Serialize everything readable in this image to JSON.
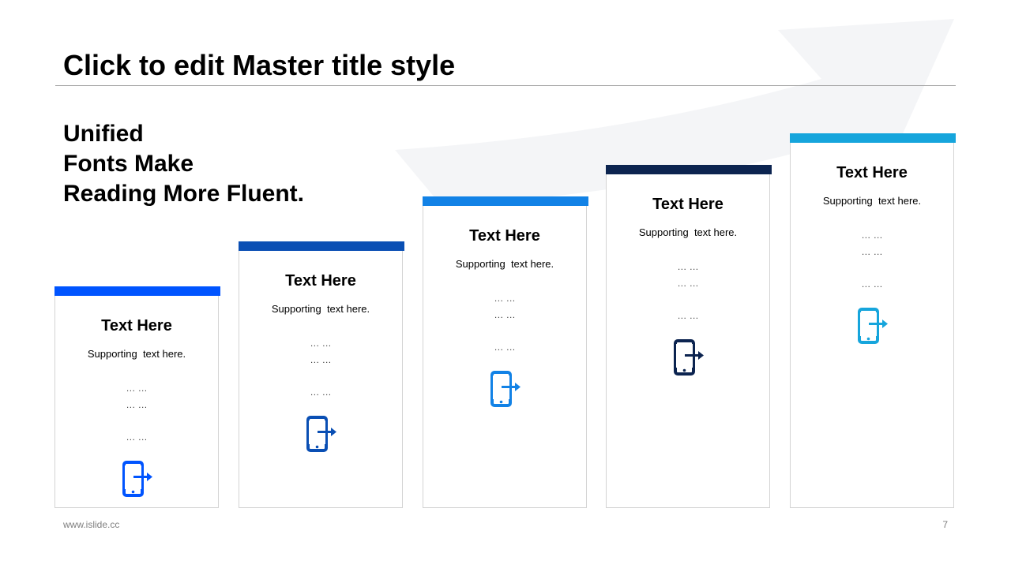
{
  "slide": {
    "title": "Click to edit Master title style",
    "subtitle_lines": [
      "Unified",
      "Fonts Make",
      "Reading More Fluent."
    ],
    "footer_url": "www.islide.cc",
    "page_number": "7"
  },
  "cards": [
    {
      "title": "Text Here",
      "supporting": "Supporting  text here.",
      "dots": [
        "… …",
        "… …",
        "… …"
      ],
      "accent": "#0054ff",
      "icon": "phone-exit-icon"
    },
    {
      "title": "Text Here",
      "supporting": "Supporting  text here.",
      "dots": [
        "… …",
        "… …",
        "… …"
      ],
      "accent": "#0a4fb4",
      "icon": "phone-exit-icon"
    },
    {
      "title": "Text Here",
      "supporting": "Supporting  text here.",
      "dots": [
        "… …",
        "… …",
        "… …"
      ],
      "accent": "#1282e6",
      "icon": "phone-exit-icon"
    },
    {
      "title": "Text Here",
      "supporting": "Supporting  text here.",
      "dots": [
        "… …",
        "… …",
        "… …"
      ],
      "accent": "#0c2450",
      "icon": "phone-exit-icon"
    },
    {
      "title": "Text Here",
      "supporting": "Supporting  text here.",
      "dots": [
        "… …",
        "… …",
        "… …"
      ],
      "accent": "#16a5dc",
      "icon": "phone-exit-icon"
    }
  ]
}
